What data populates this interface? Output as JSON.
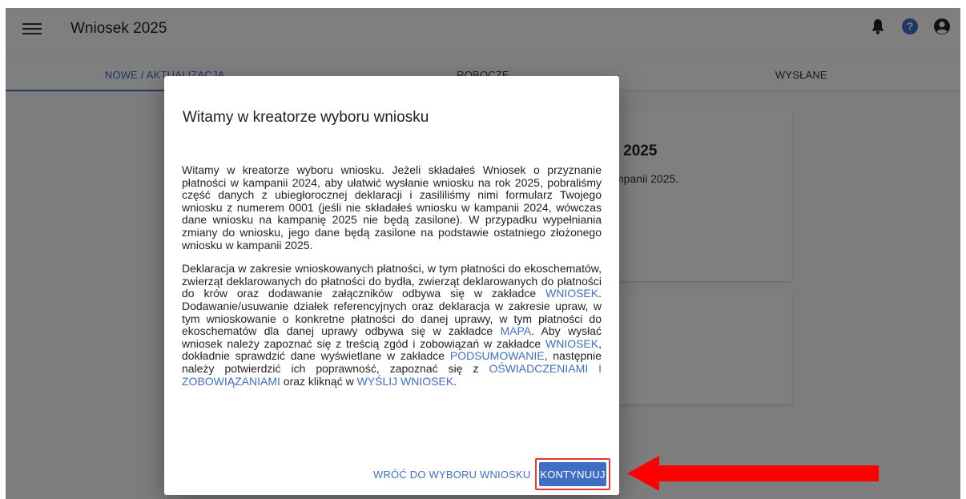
{
  "appbar": {
    "title": "Wniosek 2025",
    "icons": [
      "menu-icon",
      "bell-icon",
      "help-icon",
      "account-icon"
    ]
  },
  "tabs": [
    {
      "label": "NOWE / AKTUALIZACJA",
      "active": true
    },
    {
      "label": "ROBOCZE",
      "active": false
    },
    {
      "label": "WYSŁANE",
      "active": false
    }
  ],
  "background_card": {
    "title_fragment": "ci 2025",
    "text_fragment": "mpanii 2025."
  },
  "dialog": {
    "title": "Witamy w kreatorze wyboru wniosku",
    "paragraph1": "Witamy w kreatorze wyboru wniosku. Jeżeli składałeś Wniosek o przyznanie płatności w kampanii 2024, aby ułatwić wysłanie wniosku na rok 2025, pobraliśmy część danych z ubiegłorocznej deklaracji i zasililiśmy nimi formularz Twojego wniosku z numerem 0001 (jeśli nie składałeś wniosku w kampanii 2024, wówczas dane wniosku na kampanię 2025 nie będą zasilone). W przypadku wypełniania zmiany do wniosku, jego dane będą zasilone na podstawie ostatniego złożonego wniosku w kampanii 2025.",
    "paragraph2": {
      "t1": "Deklaracja w zakresie wnioskowanych płatności, w tym płatności do ekoschematów, zwierząt deklarowanych do płatności do bydła, zwierząt deklarowanych do płatności do krów oraz dodawanie załączników odbywa się w zakładce ",
      "link_wniosek": "WNIOSEK",
      "t2": ". Dodawanie/usuwanie działek referencyjnych oraz deklaracja w zakresie upraw, w tym wnioskowanie o konkretne płatności do danej uprawy, w tym płatności do ekoschematów dla danej uprawy odbywa się w zakładce ",
      "link_mapa": "MAPA",
      "t3": ". Aby wysłać wniosek należy zapoznać się z treścią zgód i zobowiązań w zakładce ",
      "link_wniosek2": "WNIOSEK",
      "t4": ", dokładnie sprawdzić dane wyświetlane w zakładce ",
      "link_podsumowanie": "PODSUMOWANIE",
      "t5": ", następnie należy potwierdzić ich poprawność, zapoznać się z ",
      "link_oswiadczenia": "OŚWIADCZENIAMI I ZOBOWIĄZANIAMI",
      "t6": " oraz kliknąć w ",
      "link_wyslij": "WYŚLIJ WNIOSEK",
      "t7": "."
    },
    "back_button": "WRÓĆ DO WYBORU WNIOSKU",
    "continue_button": "KONTYNUUJ"
  },
  "colors": {
    "accent": "#3f6fc5",
    "highlight": "#e53935",
    "arrow": "#ff0000"
  }
}
